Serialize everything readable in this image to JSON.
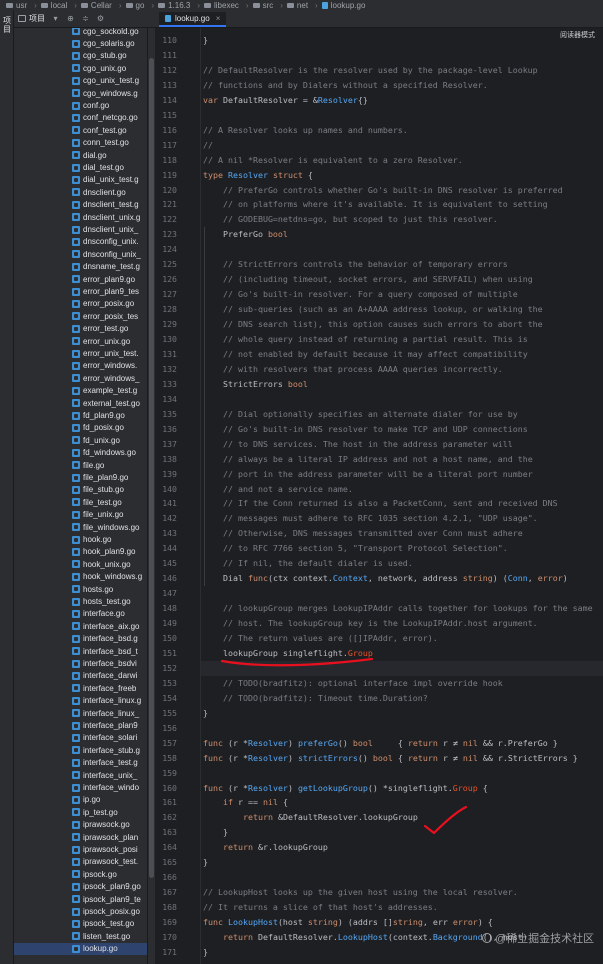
{
  "breadcrumb": [
    "usr",
    "local",
    "Cellar",
    "go",
    "1.16.3",
    "libexec",
    "src",
    "net",
    "lookup.go"
  ],
  "left_strip": {
    "label": "项目"
  },
  "panel": {
    "title": "项目",
    "collapse_icon": "chevron-down-icon"
  },
  "tab": {
    "label": "lookup.go",
    "close": "×"
  },
  "reader_mode": "阅读器模式",
  "tree": {
    "selected": "lookup.go",
    "files": [
      "cgo_sockold.go",
      "cgo_solaris.go",
      "cgo_stub.go",
      "cgo_unix.go",
      "cgo_unix_test.g",
      "cgo_windows.g",
      "conf.go",
      "conf_netcgo.go",
      "conf_test.go",
      "conn_test.go",
      "dial.go",
      "dial_test.go",
      "dial_unix_test.g",
      "dnsclient.go",
      "dnsclient_test.g",
      "dnsclient_unix.g",
      "dnsclient_unix_",
      "dnsconfig_unix.",
      "dnsconfig_unix_",
      "dnsname_test.g",
      "error_plan9.go",
      "error_plan9_tes",
      "error_posix.go",
      "error_posix_tes",
      "error_test.go",
      "error_unix.go",
      "error_unix_test.",
      "error_windows.",
      "error_windows_",
      "example_test.g",
      "external_test.go",
      "fd_plan9.go",
      "fd_posix.go",
      "fd_unix.go",
      "fd_windows.go",
      "file.go",
      "file_plan9.go",
      "file_stub.go",
      "file_test.go",
      "file_unix.go",
      "file_windows.go",
      "hook.go",
      "hook_plan9.go",
      "hook_unix.go",
      "hook_windows.g",
      "hosts.go",
      "hosts_test.go",
      "interface.go",
      "interface_aix.go",
      "interface_bsd.g",
      "interface_bsd_t",
      "interface_bsdvi",
      "interface_darwi",
      "interface_freeb",
      "interface_linux.g",
      "interface_linux_",
      "interface_plan9",
      "interface_solari",
      "interface_stub.g",
      "interface_test.g",
      "interface_unix_",
      "interface_windo",
      "ip.go",
      "ip_test.go",
      "iprawsock.go",
      "iprawsock_plan",
      "iprawsock_posi",
      "iprawsock_test.",
      "ipsock.go",
      "ipsock_plan9.go",
      "ipsock_plan9_te",
      "ipsock_posix.go",
      "ipsock_test.go",
      "listen_test.go",
      "lookup.go"
    ]
  },
  "code": {
    "lines": [
      {
        "n": "110",
        "html": "<span class=\"n\">}</span>"
      },
      {
        "n": "111",
        "html": ""
      },
      {
        "n": "112",
        "html": "<span class=\"c\">// DefaultResolver is the resolver used by the package-level Lookup</span>"
      },
      {
        "n": "113",
        "html": "<span class=\"c\">// functions and by Dialers without a specified Resolver.</span>"
      },
      {
        "n": "114",
        "html": "<span class=\"k\">var</span> DefaultResolver = &amp;<span class=\"t\">Resolver</span>{}"
      },
      {
        "n": "115",
        "html": ""
      },
      {
        "n": "116",
        "html": "<span class=\"c\">// A Resolver looks up names and numbers.</span>"
      },
      {
        "n": "117",
        "html": "<span class=\"c\">//</span>"
      },
      {
        "n": "118",
        "html": "<span class=\"c\">// A nil *Resolver is equivalent to a zero Resolver.</span>"
      },
      {
        "n": "119",
        "html": "<span class=\"k\">type</span> <span class=\"t\">Resolver</span> <span class=\"k\">struct</span> {"
      },
      {
        "n": "120",
        "html": "    <span class=\"c\">// PreferGo controls whether Go's built-in DNS resolver is preferred</span>"
      },
      {
        "n": "121",
        "html": "    <span class=\"c\">// on platforms where it's available. It is equivalent to setting</span>"
      },
      {
        "n": "122",
        "html": "    <span class=\"c\">// GODEBUG=netdns=go, but scoped to just this resolver.</span>"
      },
      {
        "n": "123",
        "html": "    PreferGo <span class=\"k\">bool</span>"
      },
      {
        "n": "124",
        "html": ""
      },
      {
        "n": "125",
        "html": "    <span class=\"c\">// StrictErrors controls the behavior of temporary errors</span>"
      },
      {
        "n": "126",
        "html": "    <span class=\"c\">// (including timeout, socket errors, and SERVFAIL) when using</span>"
      },
      {
        "n": "127",
        "html": "    <span class=\"c\">// Go's built-in resolver. For a query composed of multiple</span>"
      },
      {
        "n": "128",
        "html": "    <span class=\"c\">// sub-queries (such as an A+AAAA address lookup, or walking the</span>"
      },
      {
        "n": "129",
        "html": "    <span class=\"c\">// DNS search list), this option causes such errors to abort the</span>"
      },
      {
        "n": "130",
        "html": "    <span class=\"c\">// whole query instead of returning a partial result. This is</span>"
      },
      {
        "n": "131",
        "html": "    <span class=\"c\">// not enabled by default because it may affect compatibility</span>"
      },
      {
        "n": "132",
        "html": "    <span class=\"c\">// with resolvers that process AAAA queries incorrectly.</span>"
      },
      {
        "n": "133",
        "html": "    StrictErrors <span class=\"k\">bool</span>"
      },
      {
        "n": "134",
        "html": ""
      },
      {
        "n": "135",
        "html": "    <span class=\"c\">// Dial optionally specifies an alternate dialer for use by</span>"
      },
      {
        "n": "136",
        "html": "    <span class=\"c\">// Go's built-in DNS resolver to make TCP and UDP connections</span>"
      },
      {
        "n": "137",
        "html": "    <span class=\"c\">// to DNS services. The host in the address parameter will</span>"
      },
      {
        "n": "138",
        "html": "    <span class=\"c\">// always be a literal IP address and not a host name, and the</span>"
      },
      {
        "n": "139",
        "html": "    <span class=\"c\">// port in the address parameter will be a literal port number</span>"
      },
      {
        "n": "140",
        "html": "    <span class=\"c\">// and not a service name.</span>"
      },
      {
        "n": "141",
        "html": "    <span class=\"c\">// If the Conn returned is also a PacketConn, sent and received DNS</span>"
      },
      {
        "n": "142",
        "html": "    <span class=\"c\">// messages must adhere to RFC 1035 section 4.2.1, \"UDP usage\".</span>"
      },
      {
        "n": "143",
        "html": "    <span class=\"c\">// Otherwise, DNS messages transmitted over Conn must adhere</span>"
      },
      {
        "n": "144",
        "html": "    <span class=\"c\">// to RFC 7766 section 5, \"Transport Protocol Selection\".</span>"
      },
      {
        "n": "145",
        "html": "    <span class=\"c\">// If nil, the default dialer is used.</span>"
      },
      {
        "n": "146",
        "html": "    Dial <span class=\"k\">func</span>(ctx context.<span class=\"t\">Context</span>, network, address <span class=\"k\">string</span>) (<span class=\"t\">Conn</span>, <span class=\"k\">error</span>)"
      },
      {
        "n": "147",
        "html": ""
      },
      {
        "n": "148",
        "html": "    <span class=\"c\">// lookupGroup merges LookupIPAddr calls together for lookups for the same</span>"
      },
      {
        "n": "149",
        "html": "    <span class=\"c\">// host. The lookupGroup key is the LookupIPAddr.host argument.</span>"
      },
      {
        "n": "150",
        "html": "    <span class=\"c\">// The return values are ([]IPAddr, error).</span>"
      },
      {
        "n": "151",
        "html": "    lookupGroup singleflight.<span class=\"red\">Group</span>"
      },
      {
        "n": "152",
        "html": "",
        "hl": true
      },
      {
        "n": "153",
        "html": "    <span class=\"c\">// TODO(bradfitz): optional interface impl override hook</span>"
      },
      {
        "n": "154",
        "html": "    <span class=\"c\">// TODO(bradfitz): Timeout time.Duration?</span>"
      },
      {
        "n": "155",
        "html": "}"
      },
      {
        "n": "156",
        "html": ""
      },
      {
        "n": "157",
        "html": "<span class=\"k\">func</span> (r *<span class=\"t\">Resolver</span>) <span class=\"f\">preferGo</span>() <span class=\"k\">bool</span>     { <span class=\"k\">return</span> r ≠ <span class=\"k\">nil</span> &amp;&amp; r.PreferGo }"
      },
      {
        "n": "158",
        "html": "<span class=\"k\">func</span> (r *<span class=\"t\">Resolver</span>) <span class=\"f\">strictErrors</span>() <span class=\"k\">bool</span> { <span class=\"k\">return</span> r ≠ <span class=\"k\">nil</span> &amp;&amp; r.StrictErrors }"
      },
      {
        "n": "159",
        "html": ""
      },
      {
        "n": "160",
        "html": "<span class=\"k\">func</span> (r *<span class=\"t\">Resolver</span>) <span class=\"f\">getLookupGroup</span>() *singleflight.<span class=\"red\">Group</span> {"
      },
      {
        "n": "161",
        "html": "    <span class=\"k\">if</span> r == <span class=\"k\">nil</span> {"
      },
      {
        "n": "162",
        "html": "        <span class=\"k\">return</span> &amp;DefaultResolver.lookupGroup"
      },
      {
        "n": "163",
        "html": "    }"
      },
      {
        "n": "164",
        "html": "    <span class=\"k\">return</span> &amp;r.lookupGroup"
      },
      {
        "n": "165",
        "html": "}"
      },
      {
        "n": "166",
        "html": ""
      },
      {
        "n": "167",
        "html": "<span class=\"c\">// LookupHost looks up the given host using the local resolver.</span>"
      },
      {
        "n": "168",
        "html": "<span class=\"c\">// It returns a slice of that host's addresses.</span>"
      },
      {
        "n": "169",
        "html": "<span class=\"k\">func</span> <span class=\"f\">LookupHost</span>(host <span class=\"k\">string</span>) (addrs []<span class=\"k\">string</span>, err <span class=\"k\">error</span>) {"
      },
      {
        "n": "170",
        "html": "    <span class=\"k\">return</span> DefaultResolver.<span class=\"f\">LookupHost</span>(context.<span class=\"f\">Background</span>(), host)"
      },
      {
        "n": "171",
        "html": "}"
      }
    ]
  },
  "watermark": "@稀土掘金技术社区",
  "colors": {
    "accent": "#3574f0",
    "annotation": "#e8101e"
  }
}
